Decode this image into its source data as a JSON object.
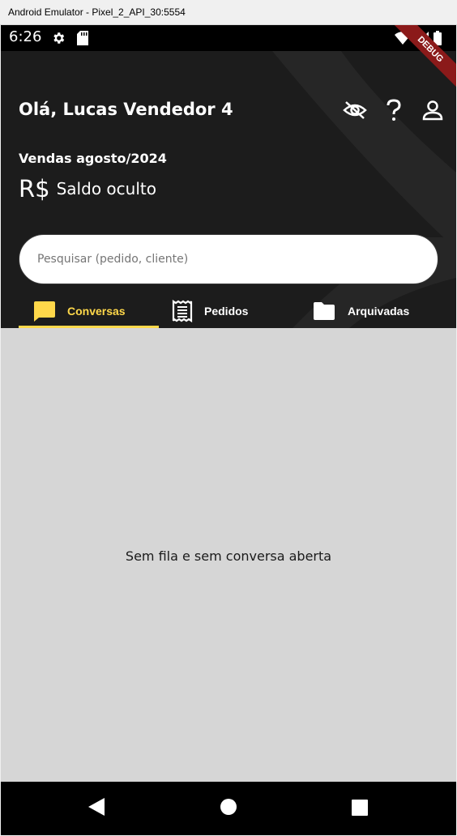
{
  "window": {
    "title": "Android Emulator - Pixel_2_API_30:5554"
  },
  "status_bar": {
    "time": "6:26"
  },
  "debug_banner": "DEBUG",
  "header": {
    "greeting": "Olá, Lucas Vendedor 4",
    "sales_period": "Vendas agosto/2024",
    "currency": "R$",
    "balance_text": "Saldo oculto",
    "search_placeholder": "Pesquisar (pedido, cliente)"
  },
  "tabs": [
    {
      "label": "Conversas",
      "icon": "chat-icon",
      "active": true
    },
    {
      "label": "Pedidos",
      "icon": "receipt-icon",
      "active": false
    },
    {
      "label": "Arquivadas",
      "icon": "folder-icon",
      "active": false
    }
  ],
  "content": {
    "empty_message": "Sem fila e sem conversa aberta"
  },
  "colors": {
    "accent": "#ffd84a",
    "header_bg": "#1c1c1c",
    "content_bg": "#d6d6d6"
  }
}
